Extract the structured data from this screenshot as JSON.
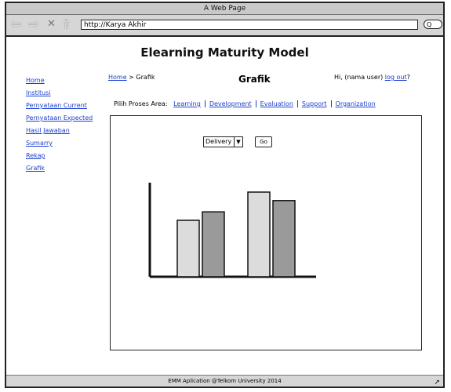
{
  "window": {
    "title": "A Web Page"
  },
  "browser": {
    "address": "http://Karya Akhir",
    "search_placeholder": "Q",
    "nav_icons": [
      "back-arrow-icon",
      "forward-arrow-icon",
      "close-icon",
      "home-icon"
    ]
  },
  "app": {
    "title": "Elearning Maturity Model"
  },
  "breadcrumb": {
    "home": "Home",
    "separator": ">",
    "current": "Grafik"
  },
  "page": {
    "title": "Grafik"
  },
  "user": {
    "greeting_prefix": "Hi, (nama user)",
    "logout": "log out",
    "suffix": "?"
  },
  "sidebar": {
    "items": [
      {
        "label": "Home"
      },
      {
        "label": "Institusi"
      },
      {
        "label": "Pernyataan Current"
      },
      {
        "label": "Pernyataan Expected"
      },
      {
        "label": "Hasil Jawaban"
      },
      {
        "label": "Sumarry"
      },
      {
        "label": "Rekap"
      },
      {
        "label": "Grafik"
      }
    ]
  },
  "process": {
    "label": "Pilih Proses Area:",
    "tabs": [
      {
        "label": "Learning"
      },
      {
        "label": "Development"
      },
      {
        "label": "Evaluation"
      },
      {
        "label": "Support"
      },
      {
        "label": "Organization"
      }
    ]
  },
  "filter": {
    "selected": "Delivery",
    "go_label": "Go"
  },
  "chart_data": {
    "type": "bar",
    "categories": [
      "",
      ""
    ],
    "series": [
      {
        "values": [
          60,
          90
        ],
        "color": "#dcdcdc"
      },
      {
        "values": [
          69,
          81
        ],
        "color": "#9a9a9a"
      }
    ],
    "title": "",
    "xlabel": "",
    "ylabel": "",
    "ylim": [
      0,
      100
    ],
    "grid": false
  },
  "footer": {
    "text": "EMM Aplication @Telkom University 2014"
  }
}
